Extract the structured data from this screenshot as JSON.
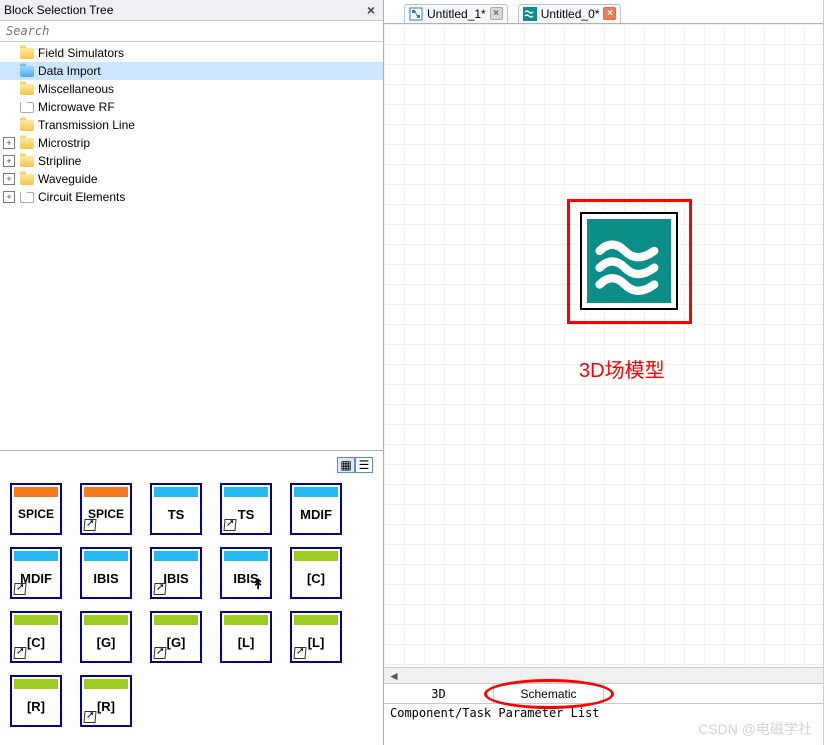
{
  "panel": {
    "title": "Block Selection Tree",
    "search_placeholder": "Search",
    "close_glyph": "×"
  },
  "tree": {
    "items": [
      {
        "label": "Field Simulators",
        "expandable": false,
        "color": "yellow",
        "selected": false
      },
      {
        "label": "Data Import",
        "expandable": false,
        "color": "blue",
        "selected": true
      },
      {
        "label": "Miscellaneous",
        "expandable": false,
        "color": "yellow",
        "selected": false
      },
      {
        "label": "Microwave RF",
        "expandable": false,
        "color": "white",
        "selected": false
      },
      {
        "label": "Transmission Line",
        "expandable": false,
        "color": "yellow",
        "selected": false
      },
      {
        "label": "Microstrip",
        "expandable": true,
        "color": "yellow",
        "selected": false
      },
      {
        "label": "Stripline",
        "expandable": true,
        "color": "yellow",
        "selected": false
      },
      {
        "label": "Waveguide",
        "expandable": true,
        "color": "yellow",
        "selected": false
      },
      {
        "label": "Circuit Elements",
        "expandable": true,
        "color": "white",
        "selected": false
      }
    ]
  },
  "view_toggle": {
    "grid_glyph": "▦",
    "list_glyph": "☰"
  },
  "thumbs": {
    "rows": [
      [
        {
          "label": "SPICE",
          "top": "orange",
          "link": false,
          "arrow": false
        },
        {
          "label": "SPICE",
          "top": "orange",
          "link": true,
          "arrow": false
        },
        {
          "label": "TS",
          "top": "cyan",
          "link": false,
          "arrow": false
        },
        {
          "label": "TS",
          "top": "cyan",
          "link": true,
          "arrow": false
        },
        {
          "label": "MDIF",
          "top": "cyan",
          "link": false,
          "arrow": false
        }
      ],
      [
        {
          "label": "MDIF",
          "top": "cyan",
          "link": true,
          "arrow": false
        },
        {
          "label": "IBIS",
          "top": "cyan",
          "link": false,
          "arrow": false
        },
        {
          "label": "IBIS",
          "top": "cyan",
          "link": true,
          "arrow": false
        },
        {
          "label": "IBIS",
          "top": "cyan",
          "link": false,
          "arrow": true
        },
        {
          "label": "[C]",
          "top": "lime",
          "link": false,
          "arrow": false
        }
      ],
      [
        {
          "label": "[C]",
          "top": "lime",
          "link": true,
          "arrow": false
        },
        {
          "label": "[G]",
          "top": "lime",
          "link": false,
          "arrow": false
        },
        {
          "label": "[G]",
          "top": "lime",
          "link": true,
          "arrow": false
        },
        {
          "label": "[L]",
          "top": "lime",
          "link": false,
          "arrow": false
        },
        {
          "label": "[L]",
          "top": "lime",
          "link": true,
          "arrow": false
        }
      ],
      [
        {
          "label": "[R]",
          "top": "lime",
          "link": false,
          "arrow": false
        },
        {
          "label": "[R]",
          "top": "lime",
          "link": true,
          "arrow": false
        }
      ]
    ]
  },
  "tabs": [
    {
      "label": "Untitled_1*",
      "icon": "schematic",
      "close_style": "grey"
    },
    {
      "label": "Untitled_0*",
      "icon": "waves",
      "close_style": "orange"
    }
  ],
  "canvas": {
    "annotation_text": "3D场模型"
  },
  "bottom_tabs": {
    "tab1": "3D",
    "tab2": "Schematic"
  },
  "param_list_label": "Component/Task Parameter List",
  "watermark": "CSDN @电磁学社",
  "expander_glyph": "+"
}
